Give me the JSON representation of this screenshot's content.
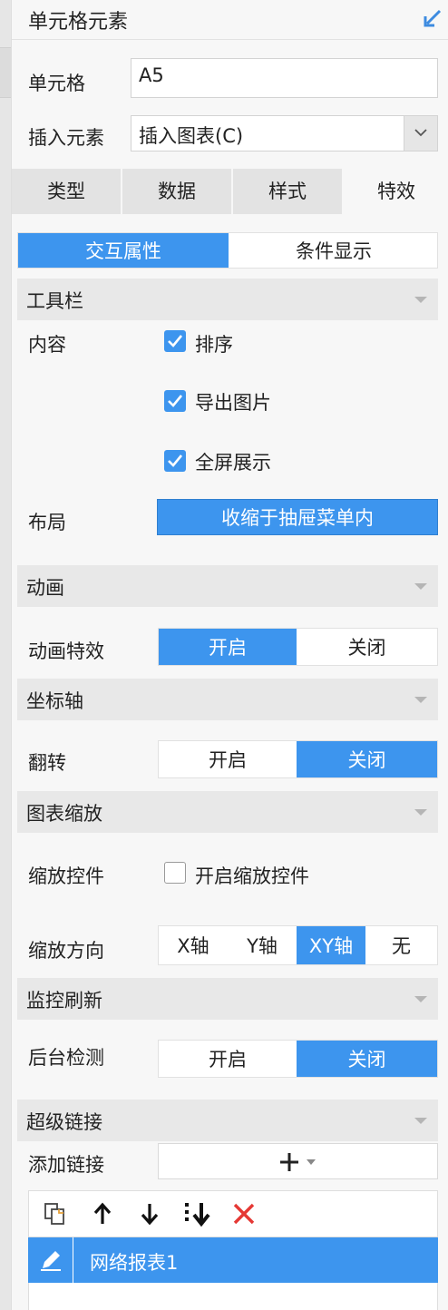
{
  "header": {
    "title": "单元格元素"
  },
  "cell": {
    "label": "单元格",
    "value": "A5"
  },
  "insert": {
    "label": "插入元素",
    "value": "插入图表(C)"
  },
  "tabs": [
    {
      "label": "类型"
    },
    {
      "label": "数据"
    },
    {
      "label": "样式"
    },
    {
      "label": "特效"
    }
  ],
  "subtabs": [
    {
      "label": "交互属性"
    },
    {
      "label": "条件显示"
    }
  ],
  "toolbar_section": {
    "title": "工具栏",
    "content_label": "内容",
    "options": [
      {
        "label": "排序",
        "checked": true
      },
      {
        "label": "导出图片",
        "checked": true
      },
      {
        "label": "全屏展示",
        "checked": true
      }
    ],
    "layout_label": "布局",
    "layout_value": "收缩于抽屉菜单内"
  },
  "animation": {
    "title": "动画",
    "label": "动画特效",
    "on": "开启",
    "off": "关闭",
    "selected": "开启"
  },
  "axis": {
    "title": "坐标轴",
    "label": "翻转",
    "on": "开启",
    "off": "关闭",
    "selected": "关闭"
  },
  "zoom": {
    "title": "图表缩放",
    "control_label": "缩放控件",
    "control_option": "开启缩放控件",
    "control_checked": false,
    "direction_label": "缩放方向",
    "directions": [
      "X轴",
      "Y轴",
      "XY轴",
      "无"
    ],
    "selected": "XY轴"
  },
  "monitor": {
    "title": "监控刷新",
    "label": "后台检测",
    "on": "开启",
    "off": "关闭",
    "selected": "关闭"
  },
  "hyperlink": {
    "title": "超级链接",
    "add_label": "添加链接",
    "items": [
      {
        "label": "网络报表1"
      }
    ]
  },
  "colors": {
    "accent": "#3d95ee",
    "delete": "#e53935"
  }
}
